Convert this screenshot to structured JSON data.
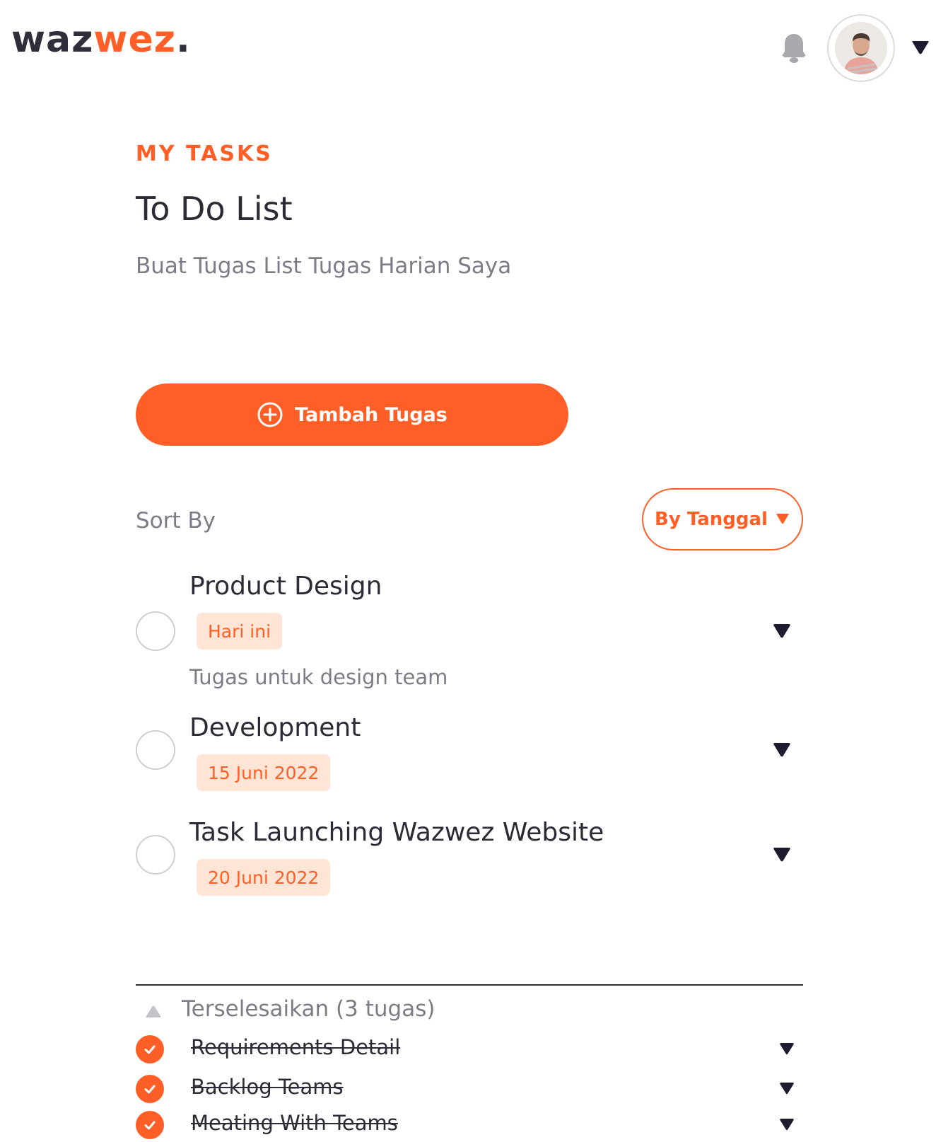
{
  "header": {
    "logo": {
      "part1": "waz",
      "part2": "wez",
      "part3": "."
    },
    "icons": {
      "bell": "bell-icon",
      "avatar": "user-avatar",
      "menu_caret": "caret-down-icon"
    }
  },
  "page": {
    "eyebrow": "MY TASKS",
    "title": "To Do List",
    "subtitle": "Buat Tugas List Tugas Harian Saya"
  },
  "add_button": {
    "label": "Tambah Tugas",
    "icon": "plus-circle-icon"
  },
  "sort": {
    "label": "Sort By",
    "selected": "By Tanggal"
  },
  "tasks": [
    {
      "title": "Product Design",
      "badge": "Hari ini",
      "description": "Tugas untuk design team"
    },
    {
      "title": "Development",
      "badge": "15 Juni 2022"
    },
    {
      "title": "Task Launching Wazwez Website",
      "badge": "20 Juni 2022"
    }
  ],
  "completed": {
    "label": "Terselesaikan (3 tugas)",
    "items": [
      {
        "title": "Requirements Detail"
      },
      {
        "title": "Backlog Teams"
      },
      {
        "title": "Meating With Teams"
      }
    ]
  },
  "colors": {
    "accent": "#ff5f26",
    "badge_bg": "#ffe5d6",
    "text": "#2b2b35",
    "muted": "#7c7c86"
  }
}
